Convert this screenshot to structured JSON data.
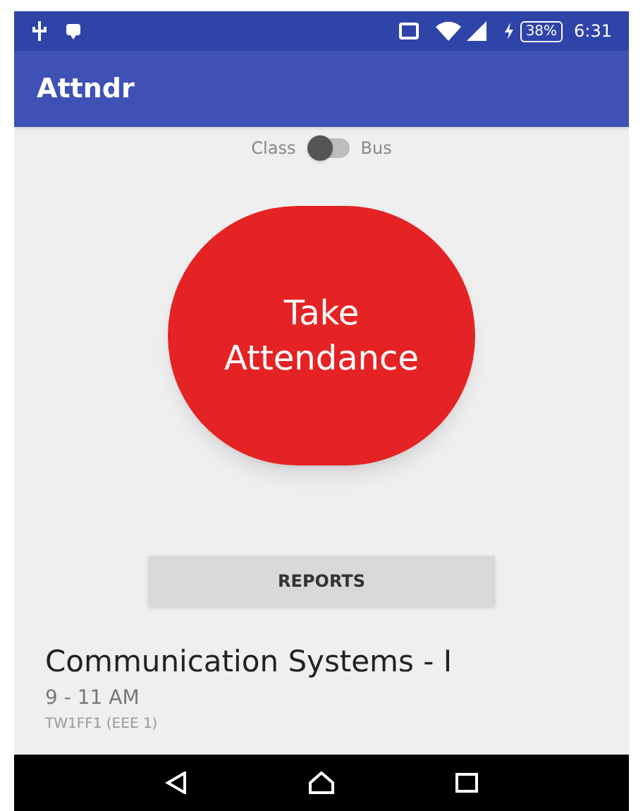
{
  "status_bar": {
    "battery": "38%",
    "time": "6:31"
  },
  "app_bar": {
    "title": "Attndr"
  },
  "mode_switch": {
    "left_label": "Class",
    "right_label": "Bus",
    "on": false
  },
  "take_attendance_button": {
    "label": "Take Attendance"
  },
  "reports_button": {
    "label": "REPORTS"
  },
  "session": {
    "course": "Communication Systems - I",
    "time": "9 - 11 AM",
    "room": "TW1FF1 (EEE 1)"
  }
}
